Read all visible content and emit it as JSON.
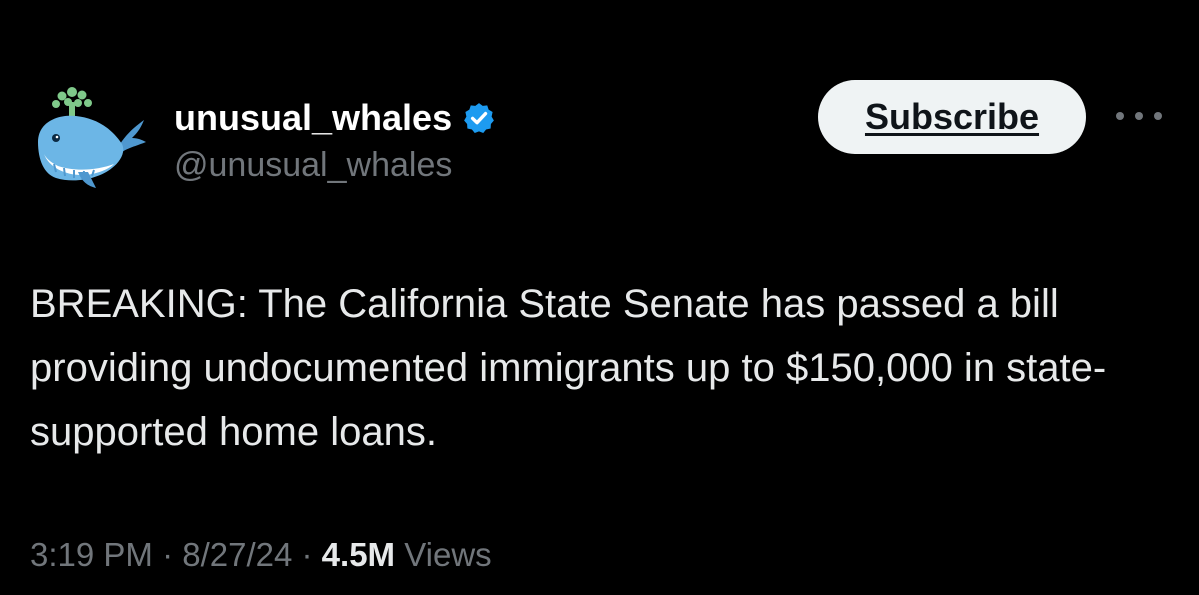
{
  "author": {
    "display_name": "unusual_whales",
    "handle": "@unusual_whales",
    "verified": true,
    "avatar_icon": "whale-icon"
  },
  "actions": {
    "subscribe_label": "Subscribe",
    "more_icon": "more-options-icon"
  },
  "tweet": {
    "text": "BREAKING: The California State Senate has passed a bill providing undocumented immigrants up to $150,000 in state-supported home loans."
  },
  "meta": {
    "time": "3:19 PM",
    "separator_1": " · ",
    "date": "8/27/24",
    "separator_2": " · ",
    "views_count": "4.5M",
    "views_label": " Views"
  },
  "colors": {
    "background": "#000000",
    "text_primary": "#e7e9ea",
    "text_secondary": "#71767b",
    "verified_blue": "#1d9bf0",
    "button_bg": "#eff3f4",
    "whale_blue": "#6cb6e6"
  }
}
